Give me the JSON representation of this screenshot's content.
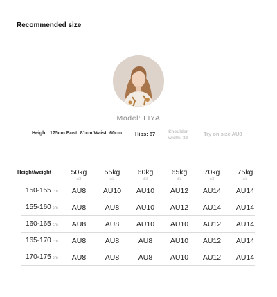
{
  "section_title": "Recommended size",
  "model": {
    "line": "Model:  LIYA",
    "height_bust_waist": "Height: 175cm Bust: 81cm Waist: 60cm",
    "hips": "Hips: 87",
    "shoulder_line1": "Shoulder",
    "shoulder_line2": "width: 38",
    "try_on": "Try on size AU8"
  },
  "table": {
    "row_header_label": "Height/weight",
    "columns": [
      {
        "weight": "50kg",
        "tolerance": "±3"
      },
      {
        "weight": "55kg",
        "tolerance": "±3"
      },
      {
        "weight": "60kg",
        "tolerance": "±3"
      },
      {
        "weight": "65kg",
        "tolerance": "±3"
      },
      {
        "weight": "70kg",
        "tolerance": "±3"
      },
      {
        "weight": "75kg",
        "tolerance": "±3"
      }
    ],
    "rows": [
      {
        "height": "150-155",
        "unit": "cm",
        "sizes": [
          "AU8",
          "AU10",
          "AU10",
          "AU12",
          "AU14",
          "AU14"
        ]
      },
      {
        "height": "155-160",
        "unit": "cm",
        "sizes": [
          "AU8",
          "AU8",
          "AU10",
          "AU12",
          "AU14",
          "AU14"
        ]
      },
      {
        "height": "160-165",
        "unit": "cm",
        "sizes": [
          "AU8",
          "AU8",
          "AU10",
          "AU10",
          "AU12",
          "AU14"
        ]
      },
      {
        "height": "165-170",
        "unit": "cm",
        "sizes": [
          "AU8",
          "AU8",
          "AU8",
          "AU10",
          "AU12",
          "AU14"
        ]
      },
      {
        "height": "170-175",
        "unit": "cm",
        "sizes": [
          "AU8",
          "AU8",
          "AU8",
          "AU10",
          "AU12",
          "AU14"
        ]
      }
    ]
  }
}
